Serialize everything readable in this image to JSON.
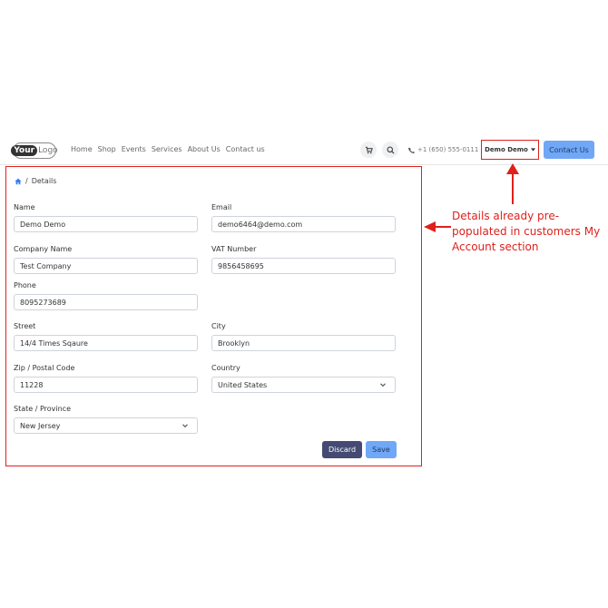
{
  "navbar": {
    "logo_bold": "Your",
    "logo_light": "Logo",
    "links": [
      "Home",
      "Shop",
      "Events",
      "Services",
      "About Us",
      "Contact us"
    ],
    "phone": "+1 (650) 555-0111",
    "user_menu_label": "Demo Demo",
    "contact_button": "Contact Us"
  },
  "breadcrumb": {
    "separator": "/",
    "current": "Details"
  },
  "form": {
    "name": {
      "label": "Name",
      "value": "Demo Demo"
    },
    "email": {
      "label": "Email",
      "value": "demo6464@demo.com"
    },
    "company": {
      "label": "Company Name",
      "value": "Test Company"
    },
    "vat": {
      "label": "VAT Number",
      "value": "9856458695"
    },
    "phone": {
      "label": "Phone",
      "value": "8095273689"
    },
    "street": {
      "label": "Street",
      "value": "14/4 Times Sqaure"
    },
    "city": {
      "label": "City",
      "value": "Brooklyn"
    },
    "zip": {
      "label": "Zip / Postal Code",
      "value": "11228"
    },
    "country": {
      "label": "Country",
      "value": "United States"
    },
    "state": {
      "label": "State / Province",
      "value": "New Jersey"
    },
    "discard_label": "Discard",
    "save_label": "Save"
  },
  "annotation": {
    "text": "Details already pre-populated in customers My Account section",
    "color": "#e0201b"
  },
  "colors": {
    "primary": "#70a7f7",
    "secondary": "#444a73",
    "highlight": "#e0201b"
  }
}
